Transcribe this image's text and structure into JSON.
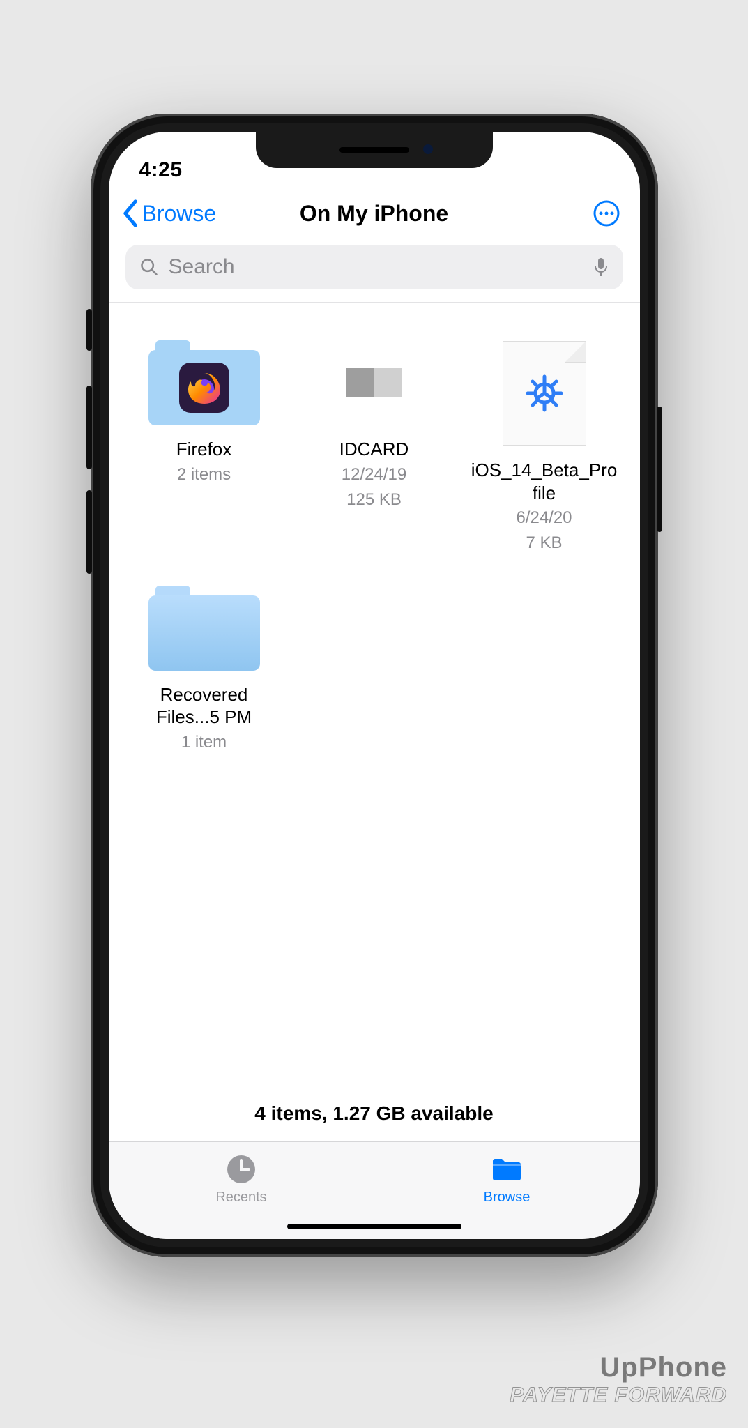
{
  "status": {
    "time": "4:25"
  },
  "nav": {
    "back_label": "Browse",
    "title": "On My iPhone"
  },
  "search": {
    "placeholder": "Search"
  },
  "items": [
    {
      "name": "Firefox",
      "sub1": "2 items",
      "sub2": "",
      "kind": "folder_firefox"
    },
    {
      "name": "IDCARD",
      "sub1": "12/24/19",
      "sub2": "125 KB",
      "kind": "image"
    },
    {
      "name": "iOS_14_Beta_Profile",
      "sub1": "6/24/20",
      "sub2": "7 KB",
      "kind": "config"
    },
    {
      "name": "Recovered Files...5 PM",
      "sub1": "1 item",
      "sub2": "",
      "kind": "folder"
    }
  ],
  "summary": "4 items, 1.27 GB available",
  "tabs": {
    "recents": "Recents",
    "browse": "Browse"
  },
  "watermark": {
    "line1": "UpPhone",
    "line2": "PAYETTE FORWARD"
  }
}
